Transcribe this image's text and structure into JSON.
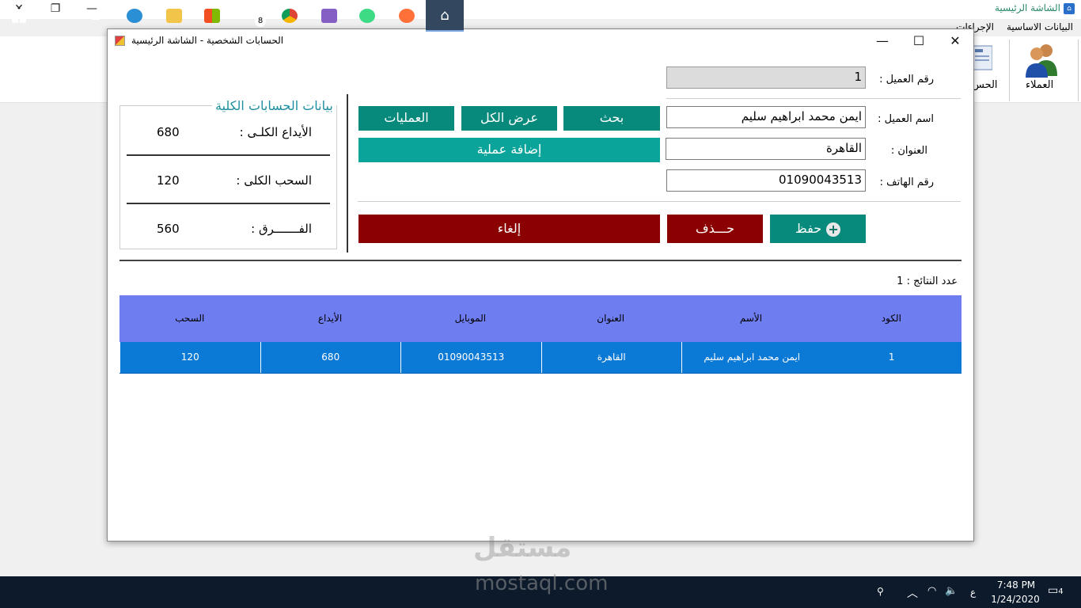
{
  "parent": {
    "title": "الشاشة الرئيسية",
    "menu": [
      "البيانات الاساسية",
      "الإجراءات"
    ],
    "toolbar": [
      {
        "label": "العملاء",
        "icon": "customers-icon"
      },
      {
        "label": "الحس",
        "icon": "accounts-icon"
      }
    ]
  },
  "window": {
    "title": "الحسابات الشخصية - الشاشة الرئيسية"
  },
  "form": {
    "id_label": "رقم العميل :",
    "id_value": "1",
    "name_label": "اسم العميل :",
    "name_value": "ايمن محمد ابراهيم سليم",
    "address_label": "العنوان :",
    "address_value": "القاهرة",
    "phone_label": "رقم الهاتف :",
    "phone_value": "01090043513"
  },
  "buttons": {
    "search": "بحث",
    "show_all": "عرض الكل",
    "operations": "العمليات",
    "add_operation": "إضافة عملية",
    "save": "حفظ",
    "delete": "حـــذف",
    "cancel": "إلغاء"
  },
  "summary": {
    "title": "بيانات الحسابات الكلية",
    "deposit_label": "الأيداع الكلـى :",
    "deposit_value": "680",
    "withdraw_label": "السحب الكلى :",
    "withdraw_value": "120",
    "diff_label": "الفـــــــرق :",
    "diff_value": "560"
  },
  "results": {
    "count_label": "عدد النتائج : 1"
  },
  "grid": {
    "columns": [
      "الكود",
      "الأسم",
      "العنوان",
      "الموبايل",
      "الأيداع",
      "السحب"
    ],
    "rows": [
      [
        "1",
        "ايمن محمد ابراهيم سليم",
        "القاهرة",
        "01090043513",
        "680",
        "120"
      ]
    ],
    "colors": {
      "header": "#6e7df0",
      "row": "#0b79d6"
    }
  },
  "taskbar": {
    "time": "7:48 PM",
    "date": "1/24/2020",
    "lang": "ع",
    "notifications": "4",
    "mail_badge": "8"
  },
  "watermark": {
    "text_ar": "مستقل",
    "text_en": "mostaql.com"
  },
  "colors": {
    "teal": "#078a7c",
    "teal_light": "#0aa49a",
    "dark_red": "#8b0000",
    "group_title": "#1e8fa0"
  }
}
